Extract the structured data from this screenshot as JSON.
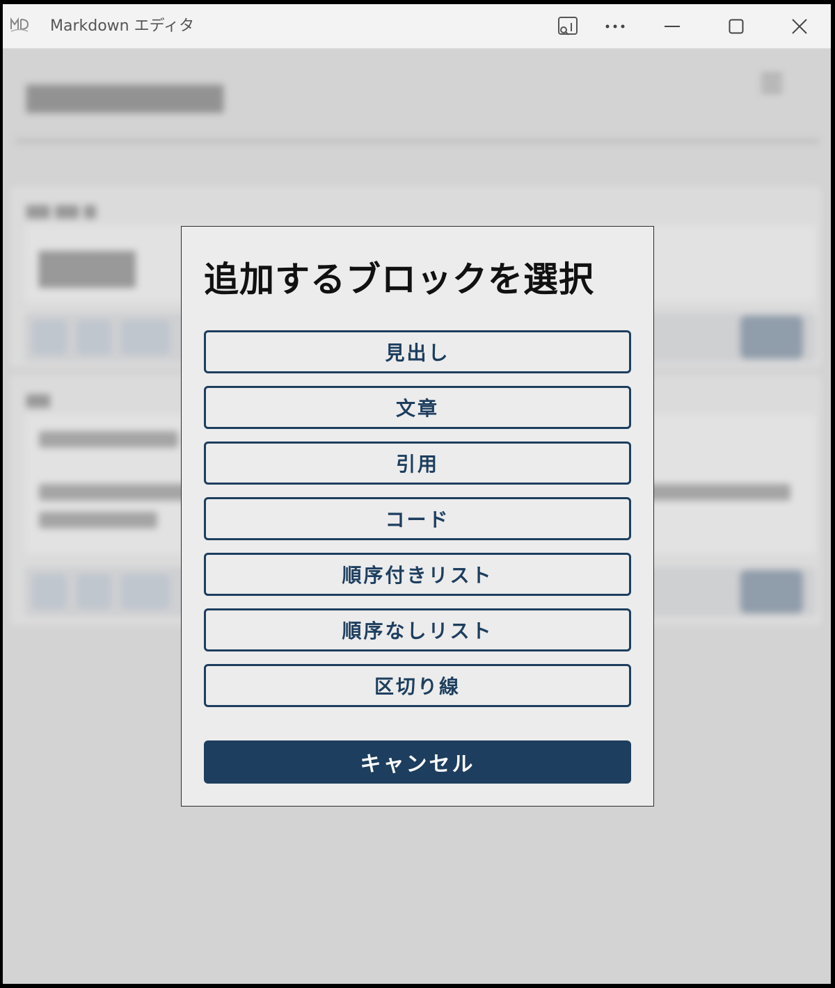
{
  "window": {
    "title": "Markdown エディタ",
    "icon": "md-logo-icon",
    "controls": [
      "cast-icon",
      "more-icon",
      "minimize-icon",
      "maximize-icon",
      "close-icon"
    ]
  },
  "dialog": {
    "title": "追加するブロックを選択",
    "options": [
      {
        "label": "見出し"
      },
      {
        "label": "文章"
      },
      {
        "label": "引用"
      },
      {
        "label": "コード"
      },
      {
        "label": "順序付きリスト"
      },
      {
        "label": "順序なしリスト"
      },
      {
        "label": "区切り線"
      }
    ],
    "cancel_label": "キャンセル"
  },
  "colors": {
    "accent": "#1d3e5e",
    "dialog_bg": "#ececec",
    "titlebar_bg": "#f3f3f3"
  }
}
